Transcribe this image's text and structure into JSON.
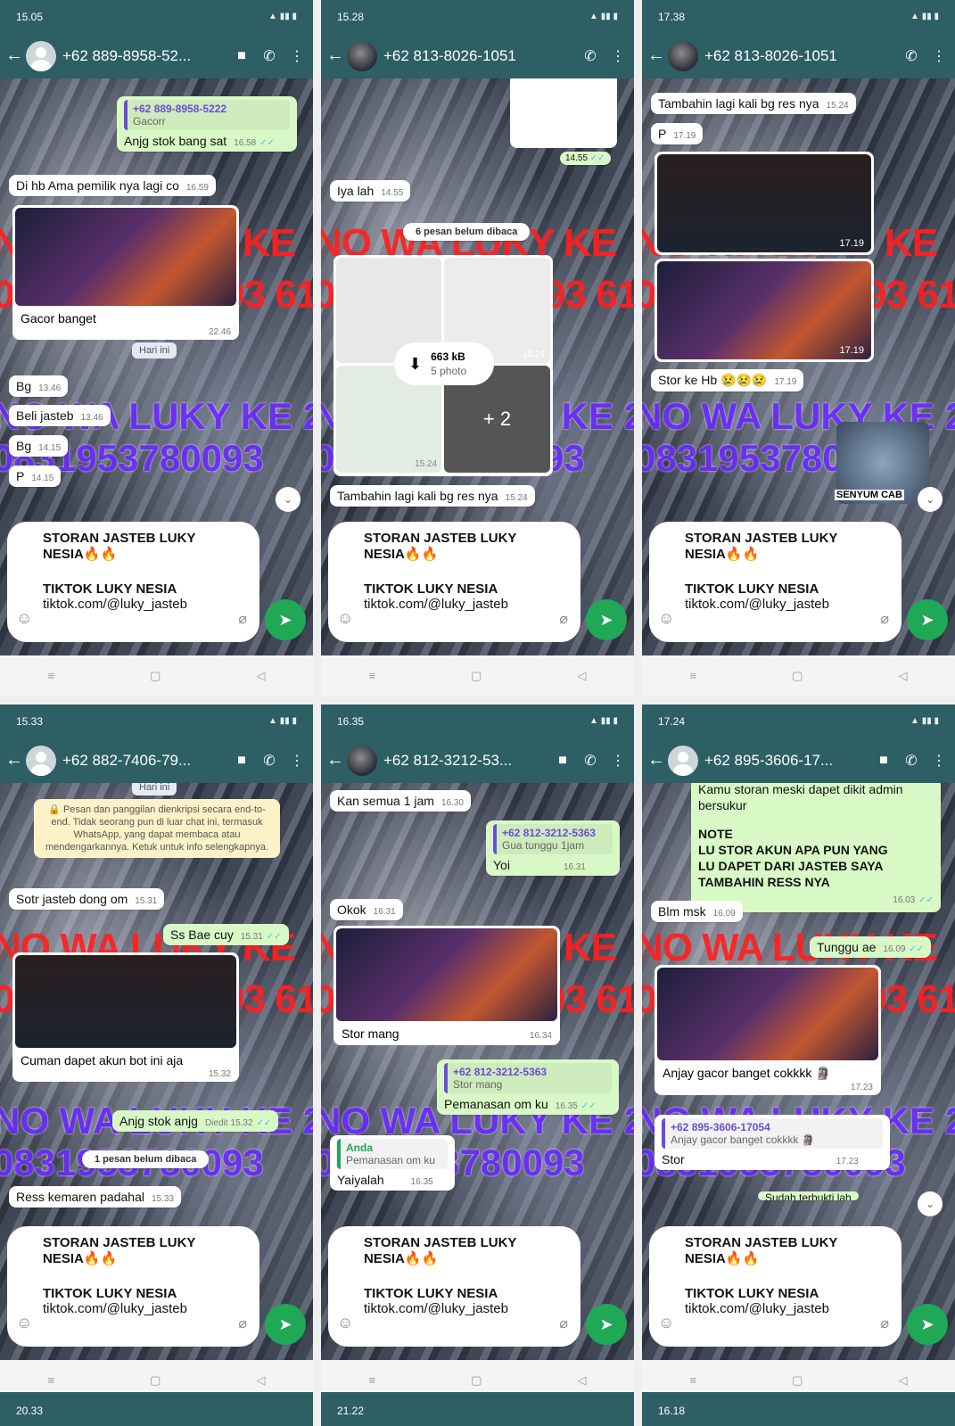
{
  "panels": [
    {
      "status_time": "15.05",
      "contact": "+62 889-8958-52...",
      "messages": {
        "q_name": "+62 889-8958-5222",
        "q_text": "Gacorr",
        "out1": "Anjg stok bang sat",
        "out1_time": "16.58",
        "in1": "Di hb Ama pemilik nya lagi co",
        "in1_time": "16.59",
        "img_caption": "Gacor banget",
        "img_time": "22.46",
        "day": "Hari ini",
        "in2": "Bg",
        "in2_time": "13.46",
        "in3": "Beli jasteb",
        "in3_time": "13.46",
        "in4": "Bg",
        "in4_time": "14.15",
        "in5": "P",
        "in5_time": "14.15"
      }
    },
    {
      "status_time": "15.28",
      "contact": "+62 813-8026-1051",
      "messages": {
        "sticker_time": "14.55",
        "in1": "Iya lah",
        "in1_time": "14.55",
        "unread": "6 pesan belum dibaca",
        "dl_size": "663 kB",
        "dl_count": "5 photo",
        "plus": "+ 2",
        "thumb_time1": "15.24",
        "thumb_time2": "15.24",
        "in2": "Tambahin lagi kali bg res nya",
        "in2_time": "15.24"
      }
    },
    {
      "status_time": "17.38",
      "contact": "+62 813-8026-1051",
      "messages": {
        "in1": "Tambahin lagi kali bg res nya",
        "in1_time": "15.24",
        "in2": "P",
        "in2_time": "17.19",
        "img1_time": "17.19",
        "img2_time": "17.19",
        "in3": "Stor ke Hb 😢😢😢",
        "in3_time": "17.19",
        "sticker_label": "SENYUM CAB"
      }
    },
    {
      "status_time": "15.33",
      "contact": "+62 882-7406-79...",
      "messages": {
        "day": "Hari ini",
        "encryption": "Pesan dan panggilan dienkripsi secara end-to-end. Tidak seorang pun di luar chat ini, termasuk WhatsApp, yang dapat membaca atau mendengarkannya. Ketuk untuk info selengkapnya.",
        "in1": "Sotr jasteb dong om",
        "in1_time": "15.31",
        "out1": "Ss Bae cuy",
        "out1_time": "15.31",
        "img_caption": "Cuman dapet akun bot ini aja",
        "img_time": "15.32",
        "out2": "Anjg stok anjg",
        "out2_time": "15.32",
        "out2_edited": "Diedit",
        "unread": "1 pesan belum dibaca",
        "in2": "Ress kemaren padahal",
        "in2_time": "15.33"
      }
    },
    {
      "status_time": "16.35",
      "contact": "+62 812-3212-53...",
      "messages": {
        "in1": "Kan semua 1 jam",
        "in1_time": "16.30",
        "q1_name": "+62 812-3212-5363",
        "q1_text": "Gua tunggu 1jam",
        "out1": "Yoi",
        "out1_time": "16.31",
        "in2": "Okok",
        "in2_time": "16.31",
        "img_caption": "Stor mang",
        "img_time": "16.34",
        "q2_name": "+62 812-3212-5363",
        "q2_text": "Stor mang",
        "out2": "Pemanasan om ku",
        "out2_time": "16.35",
        "q3_name": "Anda",
        "q3_text": "Pemanasan om ku",
        "in3": "Yaiyalah",
        "in3_time": "16.35"
      }
    },
    {
      "status_time": "17.24",
      "contact": "+62 895-3606-17...",
      "messages": {
        "out_top1": "Kamu storan meski dapet dikit admin",
        "out_top2": "bersukur",
        "note_title": "NOTE",
        "note_body": "LU STOR AKUN APA PUN YANG LU DAPET DARI JASTEB SAYA TAMBAHIN RESS NYA",
        "note_time": "16.03",
        "in1": "Blm msk",
        "in1_time": "16.09",
        "out1": "Tunggu ae",
        "out1_time": "16.09",
        "img_caption": "Anjay gacor banget cokkkk 🗿",
        "img_time": "17.23",
        "q_name": "+62 895-3606-17054",
        "q_text": "Anjay gacor banget cokkkk 🗿",
        "in2": "Stor",
        "in2_time": "17.23",
        "partial": "Sudah terbukti lah"
      }
    }
  ],
  "compose": {
    "line1": "STORAN JASTEB LUKY",
    "line2": "NESIA🔥🔥",
    "line3": "TIKTOK LUKY NESIA",
    "line4": "tiktok.com/@luky_jasteb"
  },
  "watermark": {
    "red1": "NO WA LUKY KE",
    "red2": "0831953780093 61",
    "purple1": "NO WA LUKY KE 2",
    "purple2": "0831953780093"
  },
  "bottom_times": [
    "20.33",
    "21.22",
    "16.18"
  ],
  "colors": {
    "header": "#2d5f64",
    "out_bubble": "#d8f8c6",
    "send": "#1fa855",
    "wm_red": "#ff2020",
    "wm_purple": "#6b2aff"
  }
}
